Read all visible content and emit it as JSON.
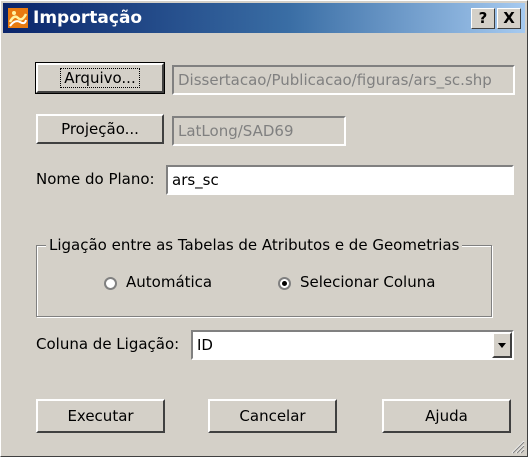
{
  "window": {
    "title": "Importação",
    "help_glyph": "?",
    "close_glyph": "X"
  },
  "file": {
    "button_label": "Arquivo...",
    "path_value": "Dissertacao/Publicacao/figuras/ars_sc.shp"
  },
  "projection": {
    "button_label": "Projeção...",
    "value": "LatLong/SAD69"
  },
  "plane": {
    "label": "Nome do Plano:",
    "value": "ars_sc"
  },
  "linkage_group": {
    "legend": "Ligação entre as Tabelas de Atributos e de Geometrias",
    "options": [
      {
        "label": "Automática",
        "selected": false
      },
      {
        "label": "Selecionar Coluna",
        "selected": true
      }
    ]
  },
  "link_column": {
    "label": "Coluna de Ligação:",
    "selected": "ID"
  },
  "actions": {
    "execute_label": "Executar",
    "cancel_label": "Cancelar",
    "help_label": "Ajuda"
  },
  "icons": {
    "app": "teview-app-icon",
    "help": "question-icon",
    "close": "close-icon",
    "dropdown": "chevron-down-icon",
    "grip": "resize-grip-icon"
  },
  "colors": {
    "titlebar_start": "#0a246a",
    "titlebar_end": "#a6caf0",
    "face": "#d4d0c8"
  }
}
